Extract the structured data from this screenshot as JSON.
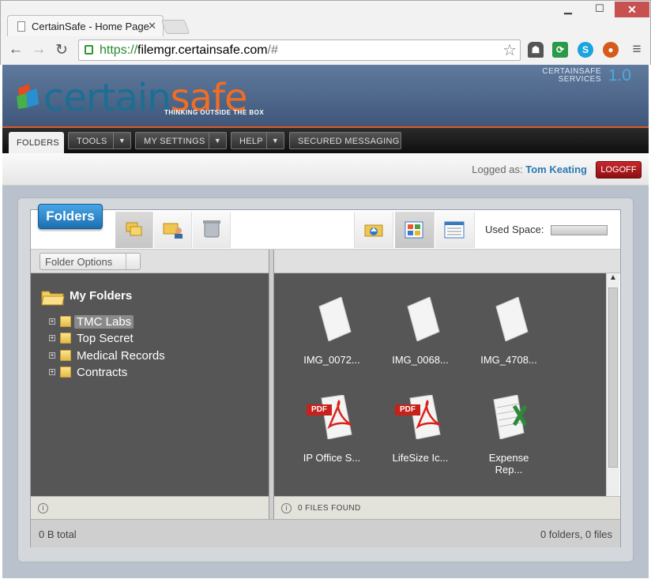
{
  "browser": {
    "tab_title": "CertainSafe - Home Page",
    "url_scheme": "https://",
    "url_host": "filemgr.certainsafe.com",
    "url_path": "/#"
  },
  "header": {
    "logo_certain": "certain",
    "logo_safe": "safe",
    "tagline": "THINKING OUTSIDE THE BOX",
    "services_line1": "CERTAINSAFE",
    "services_line2": "SERVICES",
    "version": "1.0"
  },
  "menu": {
    "folders": "FOLDERS",
    "tools": "TOOLS",
    "settings": "MY SETTINGS",
    "help": "HELP",
    "messaging": "SECURED MESSAGING"
  },
  "user": {
    "logged_label": "Logged as:",
    "name": "Tom Keating",
    "logoff": "LOGOFF"
  },
  "panel": {
    "title": "Folders",
    "used_space_label": "Used Space:",
    "used_space_fraction": 0,
    "folder_options": "Folder Options"
  },
  "tree": {
    "root": "My Folders",
    "items": [
      {
        "label": "TMC Labs"
      },
      {
        "label": "Top Secret"
      },
      {
        "label": "Medical Records"
      },
      {
        "label": "Contracts"
      }
    ]
  },
  "files": [
    {
      "name": "IMG_0072...",
      "type": "image"
    },
    {
      "name": "IMG_0068...",
      "type": "image"
    },
    {
      "name": "IMG_4708...",
      "type": "image"
    },
    {
      "name": "IP Office S...",
      "type": "pdf"
    },
    {
      "name": "LifeSize Ic...",
      "type": "pdf"
    },
    {
      "name": "Expense Rep...",
      "type": "excel"
    }
  ],
  "status": {
    "files_found": "0 FILES FOUND",
    "total": "0 B total",
    "counts": "0 folders, 0 files"
  },
  "labels": {
    "pdf": "PDF"
  },
  "colors": {
    "accent": "#f06d24",
    "brand": "#1b6f93",
    "link": "#2a7ab0",
    "logoff": "#b01c20"
  }
}
